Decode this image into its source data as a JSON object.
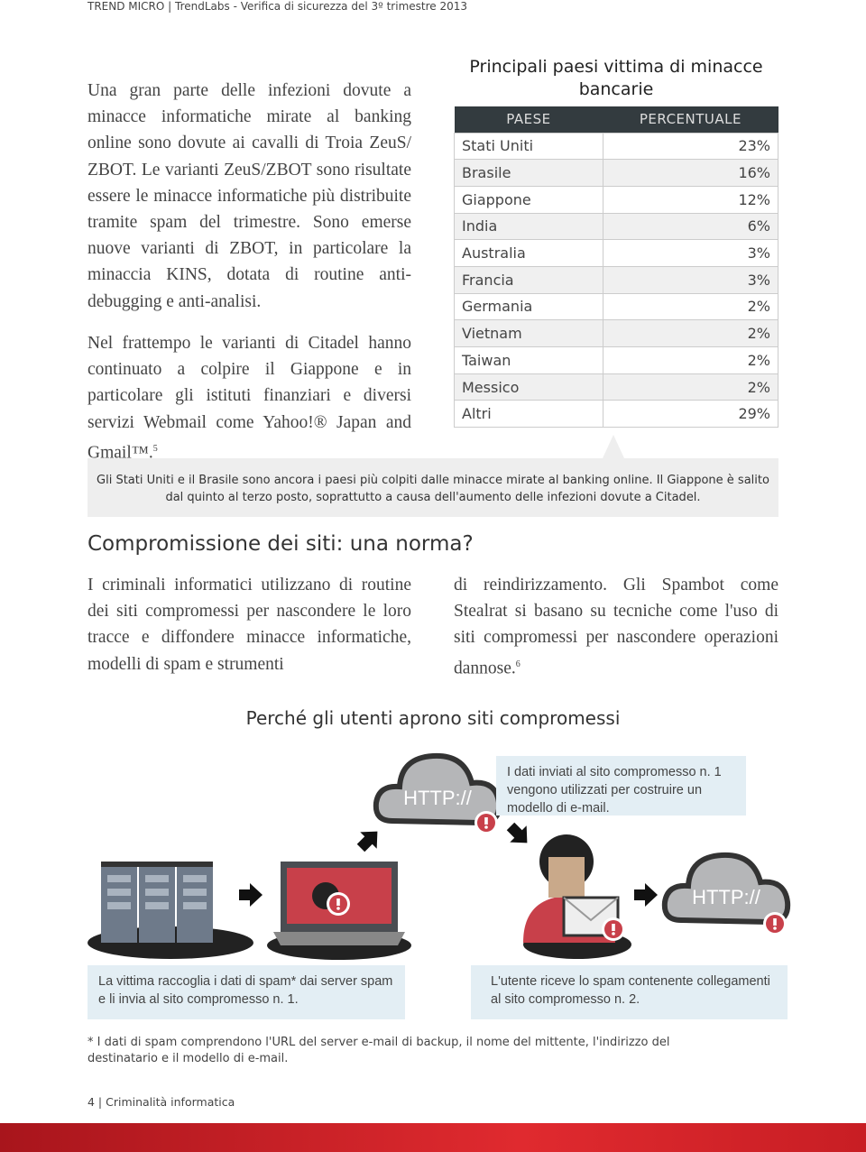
{
  "header": "TREND MICRO | TrendLabs - Verifica di sicurezza del 3º trimestre 2013",
  "left_text": {
    "p1": "Una gran parte delle infezioni dovute a minacce informatiche mirate al banking online sono dovute ai cavalli di Troia ZeuS/ ZBOT. Le varianti ZeuS/ZBOT sono risultate essere le minacce informatiche più distribuite tramite spam del trimestre. Sono emerse nuove varianti di ZBOT, in particolare la minaccia KINS, dotata di routine anti-debugging e anti-analisi.",
    "p2": "Nel frattempo le varianti di Citadel hanno continuato a colpire il Giappone e in particolare gli istituti finanziari e diversi servizi Webmail come Yahoo!® Japan and Gmail™.",
    "p2_ref": "5"
  },
  "table": {
    "title": "Principali paesi vittima di minacce bancarie",
    "headers": [
      "PAESE",
      "PERCENTUALE"
    ],
    "rows": [
      [
        "Stati Uniti",
        "23%"
      ],
      [
        "Brasile",
        "16%"
      ],
      [
        "Giappone",
        "12%"
      ],
      [
        "India",
        "6%"
      ],
      [
        "Australia",
        "3%"
      ],
      [
        "Francia",
        "3%"
      ],
      [
        "Germania",
        "2%"
      ],
      [
        "Vietnam",
        "2%"
      ],
      [
        "Taiwan",
        "2%"
      ],
      [
        "Messico",
        "2%"
      ],
      [
        "Altri",
        "29%"
      ]
    ]
  },
  "caption": "Gli Stati Uniti e il Brasile sono ancora i paesi più colpiti dalle minacce mirate al banking online. Il Giappone è salito dal quinto al terzo posto, soprattutto a causa dell'aumento delle infezioni dovute a Citadel.",
  "section": {
    "title": "Compromissione dei siti: una norma?",
    "col1": "I criminali informatici utilizzano di routine dei siti compromessi per nascondere le loro tracce e diffondere minacce informatiche, modelli di spam e strumenti",
    "col2": "di reindirizzamento. Gli Spambot come Stealrat si basano su tecniche come l'uso di siti compromessi per nascondere operazioni dannose.",
    "col2_ref": "6"
  },
  "infographic": {
    "title": "Perché gli utenti aprono siti compromessi",
    "cloud_label": "HTTP://",
    "box_top": "I dati inviati al sito compromesso n. 1 vengono utilizzati per costruire un modello di e-mail.",
    "box_left": "La vittima raccoglia i dati di spam* dai server spam e li invia al sito compromesso n. 1.",
    "box_right": "L'utente riceve lo spam contenente collegamenti al sito compromesso n. 2.",
    "colors": {
      "alert": "#c8404a",
      "cloud": "#b5b6b8",
      "box": "#e3eef4"
    }
  },
  "footnote": "* I dati di spam comprendono l'URL del server e-mail di backup, il nome del mittente, l'indirizzo del destinatario e il modello di e-mail.",
  "page": "4 | Criminalità informatica"
}
